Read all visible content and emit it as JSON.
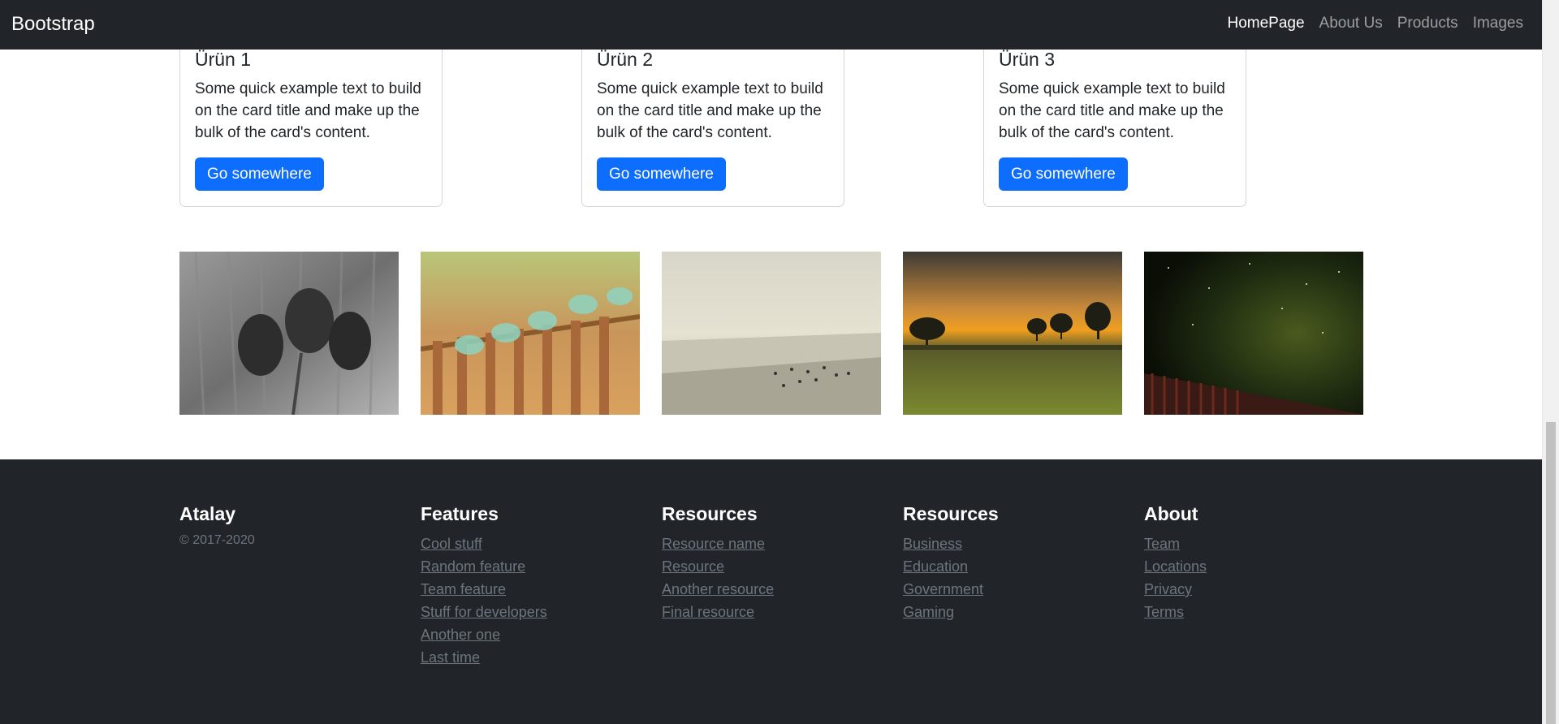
{
  "navbar": {
    "brand": "Bootstrap",
    "links": [
      "HomePage",
      "About Us",
      "Products",
      "Images"
    ]
  },
  "cards": [
    {
      "title": "Ürün 1",
      "text": "Some quick example text to build on the card title and make up the bulk of the card's content.",
      "button": "Go somewhere"
    },
    {
      "title": "Ürün 2",
      "text": "Some quick example text to build on the card title and make up the bulk of the card's content.",
      "button": "Go somewhere"
    },
    {
      "title": "Ürün 3",
      "text": "Some quick example text to build on the card title and make up the bulk of the card's content.",
      "button": "Go somewhere"
    }
  ],
  "footer": {
    "brand_col": {
      "title": "Atalay",
      "copyright": "© 2017-2020"
    },
    "columns": [
      {
        "title": "Features",
        "links": [
          "Cool stuff",
          "Random feature",
          "Team feature",
          "Stuff for developers",
          "Another one",
          "Last time"
        ]
      },
      {
        "title": "Resources",
        "links": [
          "Resource name",
          "Resource",
          "Another resource",
          "Final resource"
        ]
      },
      {
        "title": "Resources",
        "links": [
          "Business",
          "Education",
          "Government",
          "Gaming"
        ]
      },
      {
        "title": "About",
        "links": [
          "Team",
          "Locations",
          "Privacy",
          "Terms"
        ]
      }
    ]
  },
  "colors": {
    "primary": "#0d6efd",
    "dark": "#212529",
    "muted": "#6c757d"
  }
}
